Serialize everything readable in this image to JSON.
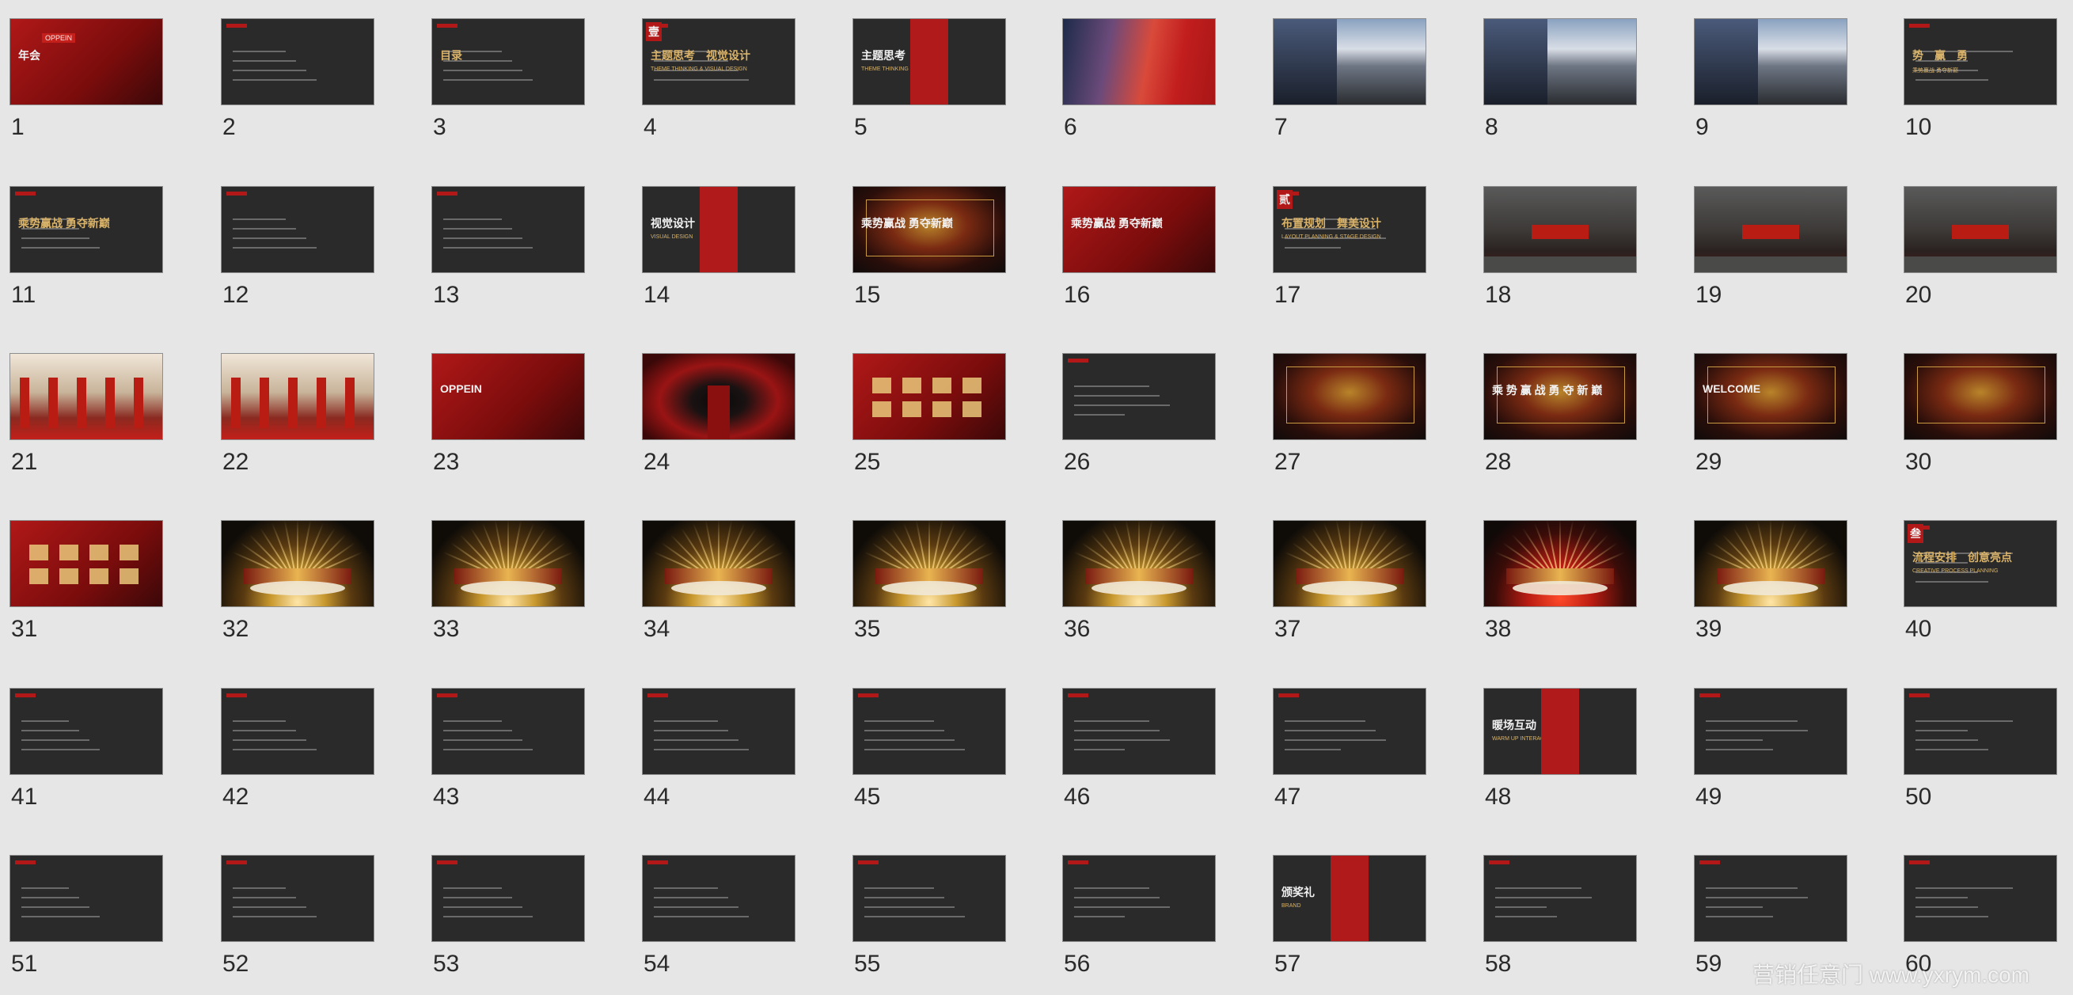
{
  "slides": [
    {
      "n": "1",
      "style": "red",
      "title": "年会",
      "badge": "OPPEIN"
    },
    {
      "n": "2",
      "style": "dark",
      "title": ""
    },
    {
      "n": "3",
      "style": "dark",
      "title": "目录"
    },
    {
      "n": "4",
      "style": "dark",
      "title": "主题思考　视觉设计",
      "subtitle": "THEME THINKING & VISUAL DESIGN",
      "chapter": "壹"
    },
    {
      "n": "5",
      "style": "redband",
      "title": "主题思考",
      "subtitle": "THEME THINKING"
    },
    {
      "n": "6",
      "style": "sunset",
      "title": ""
    },
    {
      "n": "7",
      "style": "mountain",
      "title": ""
    },
    {
      "n": "8",
      "style": "mountain",
      "title": ""
    },
    {
      "n": "9",
      "style": "mountain",
      "title": ""
    },
    {
      "n": "10",
      "style": "dark",
      "title": "势　赢　勇",
      "subtitle": "乘势赢战 勇夺新巅"
    },
    {
      "n": "11",
      "style": "dark",
      "title": "乘势赢战 勇夺新巅"
    },
    {
      "n": "12",
      "style": "dark",
      "title": ""
    },
    {
      "n": "13",
      "style": "dark",
      "title": ""
    },
    {
      "n": "14",
      "style": "redband",
      "title": "视觉设计",
      "subtitle": "VISUAL DESIGN"
    },
    {
      "n": "15",
      "style": "gold",
      "title": "乘势赢战 勇夺新巅"
    },
    {
      "n": "16",
      "style": "red",
      "title": "乘势赢战 勇夺新巅"
    },
    {
      "n": "17",
      "style": "dark",
      "title": "布置规划　舞美设计",
      "subtitle": "LAYOUT PLANNING & STAGE DESIGN",
      "chapter": "贰"
    },
    {
      "n": "18",
      "style": "building",
      "title": ""
    },
    {
      "n": "19",
      "style": "building",
      "title": ""
    },
    {
      "n": "20",
      "style": "building",
      "title": ""
    },
    {
      "n": "21",
      "style": "hall",
      "title": ""
    },
    {
      "n": "22",
      "style": "hall",
      "title": ""
    },
    {
      "n": "23",
      "style": "red",
      "title": "OPPEIN"
    },
    {
      "n": "24",
      "style": "redcarpet",
      "title": ""
    },
    {
      "n": "25",
      "style": "red",
      "title": ""
    },
    {
      "n": "26",
      "style": "dark",
      "title": ""
    },
    {
      "n": "27",
      "style": "gold",
      "title": ""
    },
    {
      "n": "28",
      "style": "gold",
      "title": "乘 势 赢 战 勇 夺 新 巅"
    },
    {
      "n": "29",
      "style": "gold",
      "title": "WELCOME"
    },
    {
      "n": "30",
      "style": "gold",
      "title": ""
    },
    {
      "n": "31",
      "style": "red",
      "title": ""
    },
    {
      "n": "32",
      "style": "stage",
      "title": ""
    },
    {
      "n": "33",
      "style": "stage",
      "title": ""
    },
    {
      "n": "34",
      "style": "stage",
      "title": ""
    },
    {
      "n": "35",
      "style": "stage",
      "title": ""
    },
    {
      "n": "36",
      "style": "stage",
      "title": ""
    },
    {
      "n": "37",
      "style": "stage",
      "title": ""
    },
    {
      "n": "38",
      "style": "stagered",
      "title": ""
    },
    {
      "n": "39",
      "style": "stage",
      "title": ""
    },
    {
      "n": "40",
      "style": "dark",
      "title": "流程安排　创意亮点",
      "subtitle": "CREATIVE PROCESS PLANNING",
      "chapter": "叁"
    },
    {
      "n": "41",
      "style": "dark",
      "title": ""
    },
    {
      "n": "42",
      "style": "dark",
      "title": ""
    },
    {
      "n": "43",
      "style": "dark",
      "title": ""
    },
    {
      "n": "44",
      "style": "dark",
      "title": ""
    },
    {
      "n": "45",
      "style": "dark",
      "title": ""
    },
    {
      "n": "46",
      "style": "dark",
      "title": ""
    },
    {
      "n": "47",
      "style": "dark",
      "title": ""
    },
    {
      "n": "48",
      "style": "redband",
      "title": "暖场互动",
      "subtitle": "WARM UP INTERACTION"
    },
    {
      "n": "49",
      "style": "dark",
      "title": ""
    },
    {
      "n": "50",
      "style": "dark",
      "title": ""
    },
    {
      "n": "51",
      "style": "dark",
      "title": ""
    },
    {
      "n": "52",
      "style": "dark",
      "title": ""
    },
    {
      "n": "53",
      "style": "dark",
      "title": ""
    },
    {
      "n": "54",
      "style": "dark",
      "title": ""
    },
    {
      "n": "55",
      "style": "dark",
      "title": ""
    },
    {
      "n": "56",
      "style": "dark",
      "title": ""
    },
    {
      "n": "57",
      "style": "redband",
      "title": "颁奖礼",
      "subtitle": "BRAND"
    },
    {
      "n": "58",
      "style": "dark",
      "title": ""
    },
    {
      "n": "59",
      "style": "dark",
      "title": ""
    },
    {
      "n": "60",
      "style": "dark",
      "title": ""
    }
  ],
  "watermark": "营销任意门 www.yxrym.com",
  "colors": {
    "background": "#e6e6e6",
    "accent_red": "#b31818",
    "gold": "#d9b36a",
    "number_text": "#2a2a2a"
  }
}
